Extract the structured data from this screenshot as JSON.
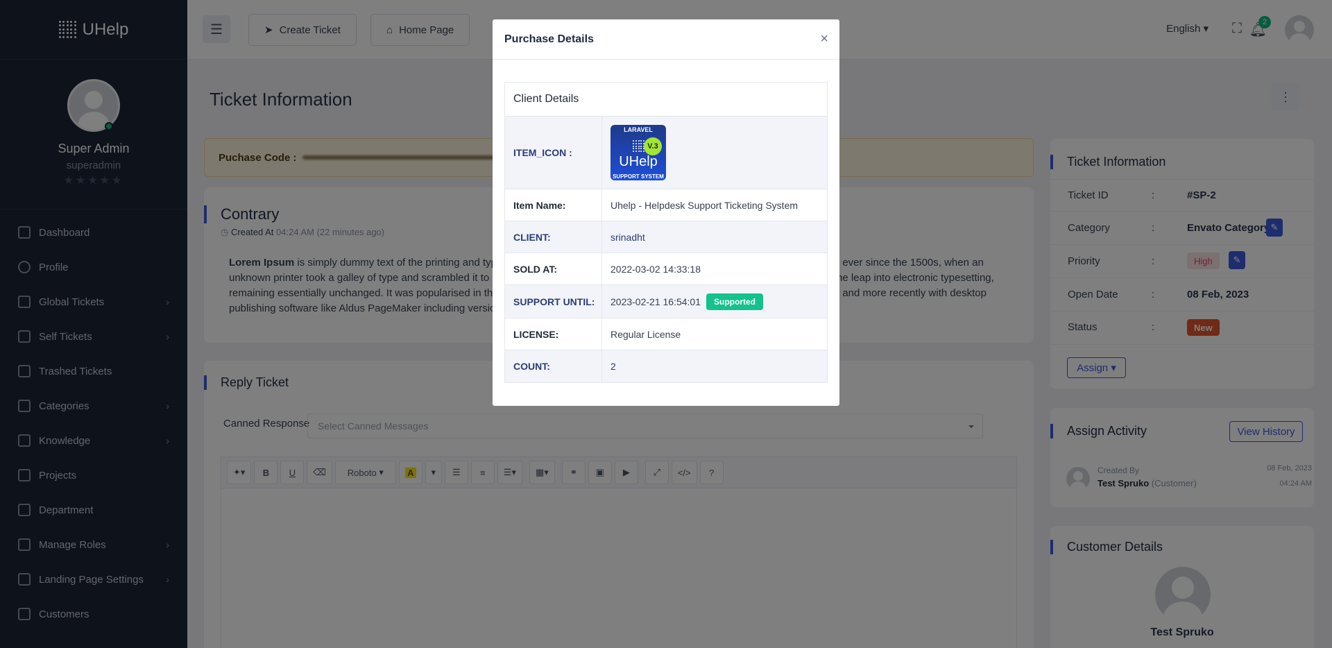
{
  "app": {
    "name": "UHelp"
  },
  "sidebar": {
    "user_name": "Super Admin",
    "user_role": "superadmin",
    "rating_stars": "★★★★★",
    "items": [
      {
        "label": "Dashboard",
        "icon": "dashboard-icon",
        "has_children": false
      },
      {
        "label": "Profile",
        "icon": "user-icon",
        "has_children": false
      },
      {
        "label": "Global Tickets",
        "icon": "ticket-icon",
        "has_children": true
      },
      {
        "label": "Self Tickets",
        "icon": "ticket-icon",
        "has_children": true
      },
      {
        "label": "Trashed Tickets",
        "icon": "trash-icon",
        "has_children": false
      },
      {
        "label": "Categories",
        "icon": "category-icon",
        "has_children": true
      },
      {
        "label": "Knowledge",
        "icon": "knowledge-icon",
        "has_children": true
      },
      {
        "label": "Projects",
        "icon": "projects-icon",
        "has_children": false
      },
      {
        "label": "Department",
        "icon": "department-icon",
        "has_children": false
      },
      {
        "label": "Manage Roles",
        "icon": "roles-icon",
        "has_children": true
      },
      {
        "label": "Landing Page Settings",
        "icon": "settings-icon",
        "has_children": true
      },
      {
        "label": "Customers",
        "icon": "customers-icon",
        "has_children": false
      }
    ]
  },
  "topbar": {
    "create_ticket": "Create Ticket",
    "home_page": "Home Page",
    "language": "English",
    "notification_count": "2"
  },
  "main": {
    "page_title": "Ticket Information",
    "purchase_code_label": "Puchase Code :",
    "ticket": {
      "title": "Contrary",
      "created_label": "Created At",
      "created_value": "04:24 AM (22 minutes ago)",
      "desc_bold": "Lorem Ipsum",
      "desc_line1": " is simply dummy text of the printing and typ",
      "desc_line1_right": "t ever since the 1500s, when an",
      "desc_line2": "unknown printer took a galley of type and scrambled it to m",
      "desc_line2_right": "he leap into electronic typesetting,",
      "desc_line3": "remaining essentially unchanged. It was popularised in the",
      "desc_line3_right": ", and more recently with desktop",
      "desc_line4": "publishing software like Aldus PageMaker including version"
    },
    "reply": {
      "title": "Reply Ticket",
      "canned_label": "Canned Response",
      "canned_placeholder": "Select Canned Messages",
      "font_name": "Roboto"
    }
  },
  "ticket_info": {
    "title": "Ticket Information",
    "rows": [
      {
        "label": "Ticket ID",
        "sep": ":",
        "value": "#SP-2"
      },
      {
        "label": "Category",
        "sep": ":",
        "value": "Envato Category"
      },
      {
        "label": "Priority",
        "sep": ":",
        "value": "High"
      },
      {
        "label": "Open Date",
        "sep": ":",
        "value": "08 Feb, 2023"
      },
      {
        "label": "Status",
        "sep": ":",
        "value": "New"
      }
    ],
    "assign_label": "Assign"
  },
  "assign_activity": {
    "title": "Assign Activity",
    "view_history": "View History",
    "created_by_label": "Created By",
    "user": "Test Spruko",
    "user_type": "(Customer)",
    "date": "08 Feb, 2023",
    "time": "04:24 AM"
  },
  "customer_details": {
    "title": "Customer Details",
    "name": "Test Spruko"
  },
  "modal": {
    "title": "Purchase Details",
    "close": "×",
    "caption": "Client Details",
    "icon_texts": {
      "top": "LARAVEL",
      "version": "V.3",
      "brand": "UHelp",
      "bottom": "SUPPORT SYSTEM"
    },
    "rows": [
      {
        "key": "ITEM_ICON :",
        "value": ""
      },
      {
        "key": "Item Name:",
        "value": "Uhelp - Helpdesk Support Ticketing System"
      },
      {
        "key": "CLIENT:",
        "value": "srinadht"
      },
      {
        "key": "SOLD AT:",
        "value": "2022-03-02 14:33:18"
      },
      {
        "key": "SUPPORT UNTIL:",
        "value": "2023-02-21 16:54:01",
        "badge": "Supported"
      },
      {
        "key": "LICENSE:",
        "value": "Regular License"
      },
      {
        "key": "COUNT:",
        "value": "2"
      }
    ]
  },
  "colors": {
    "sidebar_bg": "#1b2536",
    "primary": "#3b5bdb",
    "success": "#13c28c",
    "danger": "#e0542b"
  }
}
